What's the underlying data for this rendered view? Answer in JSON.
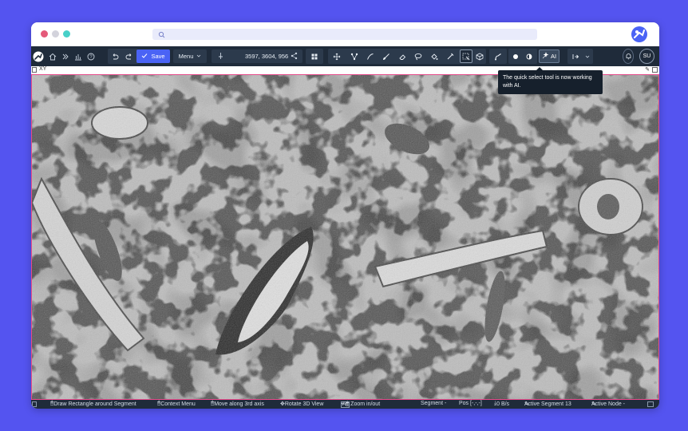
{
  "toolbar": {
    "save_label": "Save",
    "menu_label": "Menu",
    "position": "3597, 3604, 956",
    "ai_label": "AI",
    "user_initials": "SU"
  },
  "viewport": {
    "label": "XY"
  },
  "tooltip": {
    "text": "The quick select tool is now working with AI."
  },
  "statusbar": {
    "hint1": "Draw Rectangle around Segment",
    "hint2": "Context Menu",
    "hint3": "Move along 3rd axis",
    "hint4": "Rotate 3D View",
    "hint5_key": "Alt",
    "hint5": "+ 🖱 Zoom in/out",
    "segment": "Segment -",
    "pos": "Pos [-,-,-]",
    "bandwidth": "0 B/s",
    "active_segment": "Active Segment 13",
    "active_node": "Active Node -"
  },
  "colors": {
    "background": "#5454f0",
    "toolbar": "#1f2b3a",
    "accent": "#4a63f5",
    "viewport_border": "#e64a8a"
  },
  "icons": [
    "search-icon",
    "webknossos-logo",
    "home-icon",
    "dataset-icon",
    "stats-icon",
    "help-icon",
    "undo-icon",
    "redo-icon",
    "check-icon",
    "pin-icon",
    "share-icon",
    "layout-icon",
    "move-icon",
    "skeleton-icon",
    "brush-icon",
    "eraser-icon",
    "lasso-icon",
    "fill-icon",
    "picker-icon",
    "quick-select-icon",
    "bounding-box-icon",
    "proofread-icon",
    "overwrite-icon",
    "merge-icon",
    "ai-icon",
    "split-icon",
    "bell-icon"
  ]
}
